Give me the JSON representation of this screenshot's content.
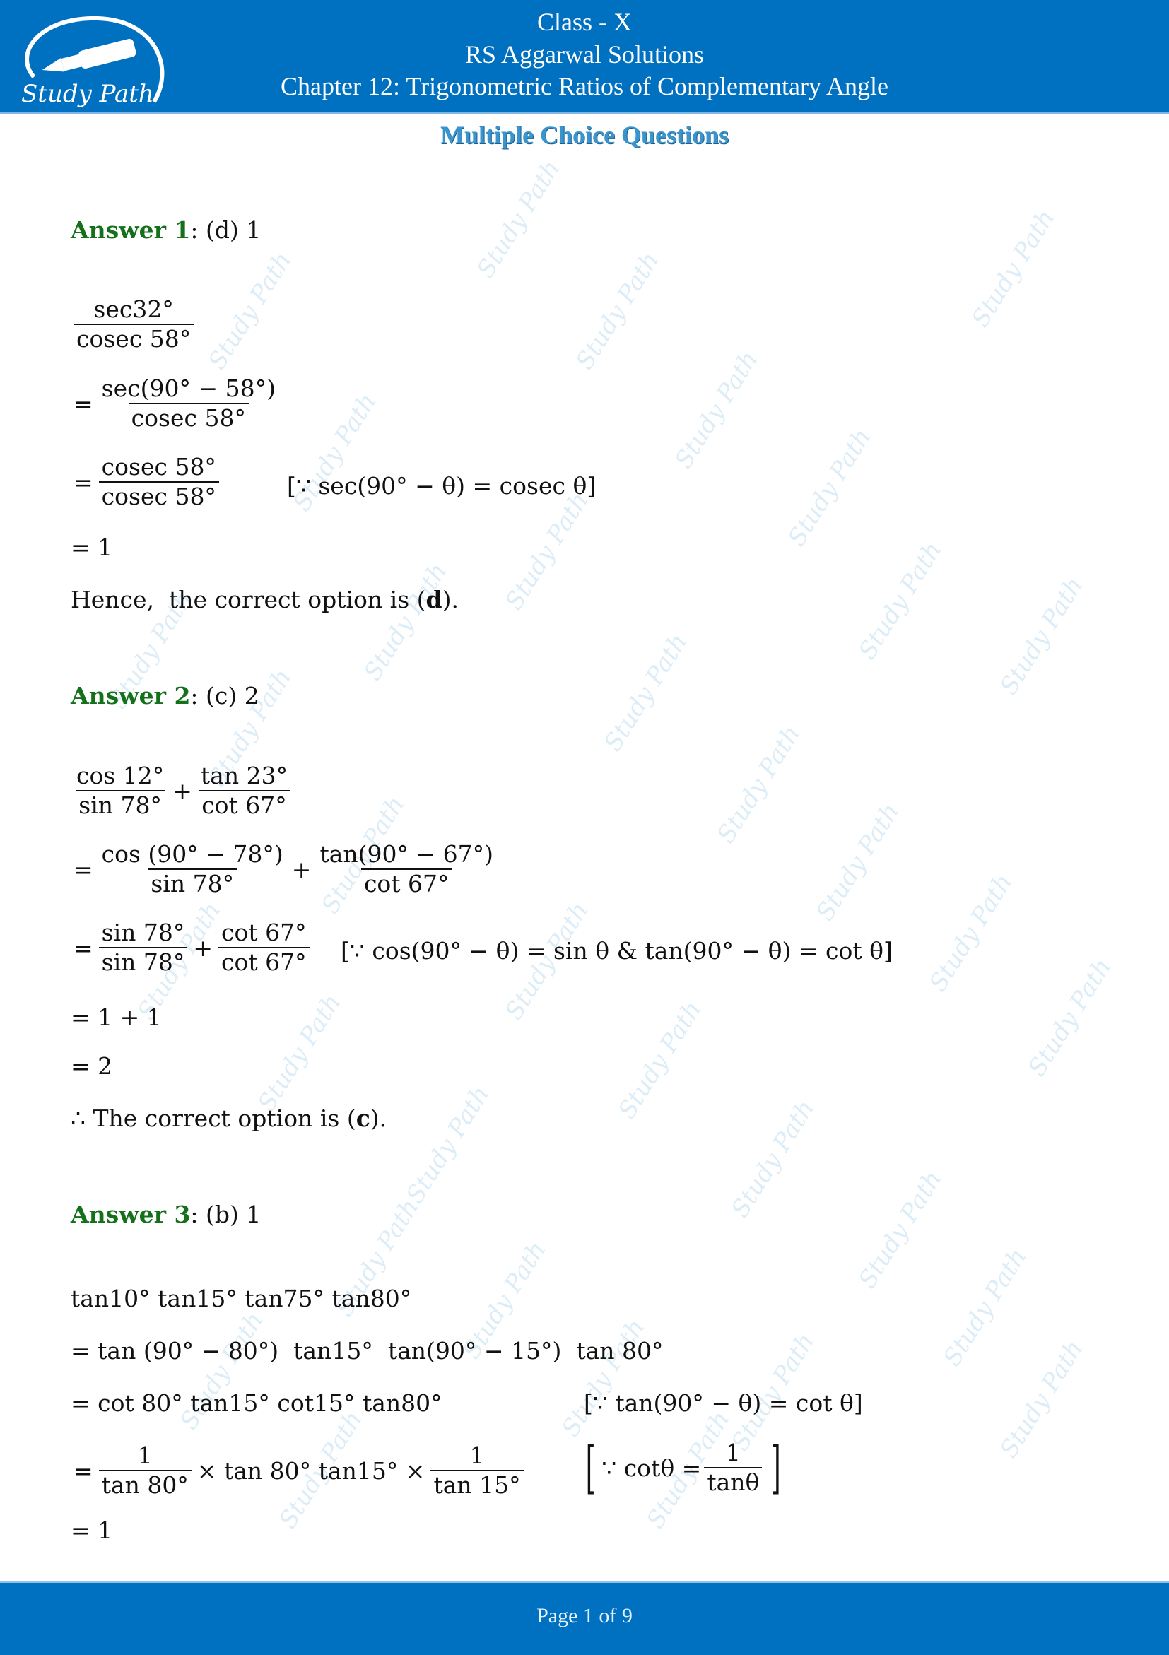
{
  "header": {
    "logo_text": "Study Path",
    "class_line": "Class - X",
    "book_line": "RS Aggarwal Solutions",
    "chapter_line": "Chapter 12: Trigonometric Ratios of Complementary Angle"
  },
  "section_title": "Multiple Choice Questions",
  "answers": [
    {
      "label": "Answer 1",
      "choice": ": (d) 1",
      "steps": {
        "s1_num": "sec32°",
        "s1_den": "cosec 58°",
        "s2_eq": "=",
        "s2_num": "sec(90° − 58°)",
        "s2_den": "cosec 58°",
        "s3_eq": "=",
        "s3_num": "cosec 58°",
        "s3_den": "cosec 58°",
        "s3_note": "[∵ sec(90° − θ) = cosec θ]",
        "s4": "= 1",
        "conclusion_pre": "Hence,  the correct option is (",
        "conclusion_opt": "d",
        "conclusion_post": ")."
      }
    },
    {
      "label": "Answer 2",
      "choice": ": (c) 2",
      "steps": {
        "s1_a_num": "cos 12°",
        "s1_a_den": "sin 78°",
        "s1_plus": "+",
        "s1_b_num": "tan 23°",
        "s1_b_den": "cot 67°",
        "s2_eq": "=",
        "s2_a_num": "cos (90° − 78°)",
        "s2_a_den": "sin 78°",
        "s2_plus": "+",
        "s2_b_num": "tan(90° − 67°)",
        "s2_b_den": "cot 67°",
        "s3_eq": "=",
        "s3_a_num": "sin 78°",
        "s3_a_den": "sin 78°",
        "s3_plus": "+",
        "s3_b_num": "cot 67°",
        "s3_b_den": "cot 67°",
        "s3_note": "[∵ cos(90° − θ) = sin θ & tan(90° − θ) = cot θ]",
        "s4": "= 1 + 1",
        "s5": "= 2",
        "conclusion_pre": "∴ The correct option is (",
        "conclusion_opt": "c",
        "conclusion_post": ")."
      }
    },
    {
      "label": "Answer 3",
      "choice": ": (b) 1",
      "steps": {
        "s1": "tan10° tan15° tan75° tan80°",
        "s2": "= tan (90° − 80°)  tan15°  tan(90° − 15°)  tan 80°",
        "s3": "= cot 80° tan15° cot15° tan80°",
        "s3_note": "[∵ tan(90° − θ) = cot θ]",
        "s4_eq": "=",
        "s4_a_num": "1",
        "s4_a_den": "tan 80°",
        "s4_mid": "× tan 80° tan15° ×",
        "s4_b_num": "1",
        "s4_b_den": "tan 15°",
        "s4_note_pre": "∵ cotθ =",
        "s4_note_num": "1",
        "s4_note_den": "tanθ",
        "s5": "= 1"
      }
    }
  ],
  "footer": {
    "page_label": "Page 1 of 9"
  },
  "watermark": "Study Path",
  "colors": {
    "brand_blue": "#0070c0",
    "answer_green": "#15701b",
    "title_blue": "#3b95cd"
  }
}
